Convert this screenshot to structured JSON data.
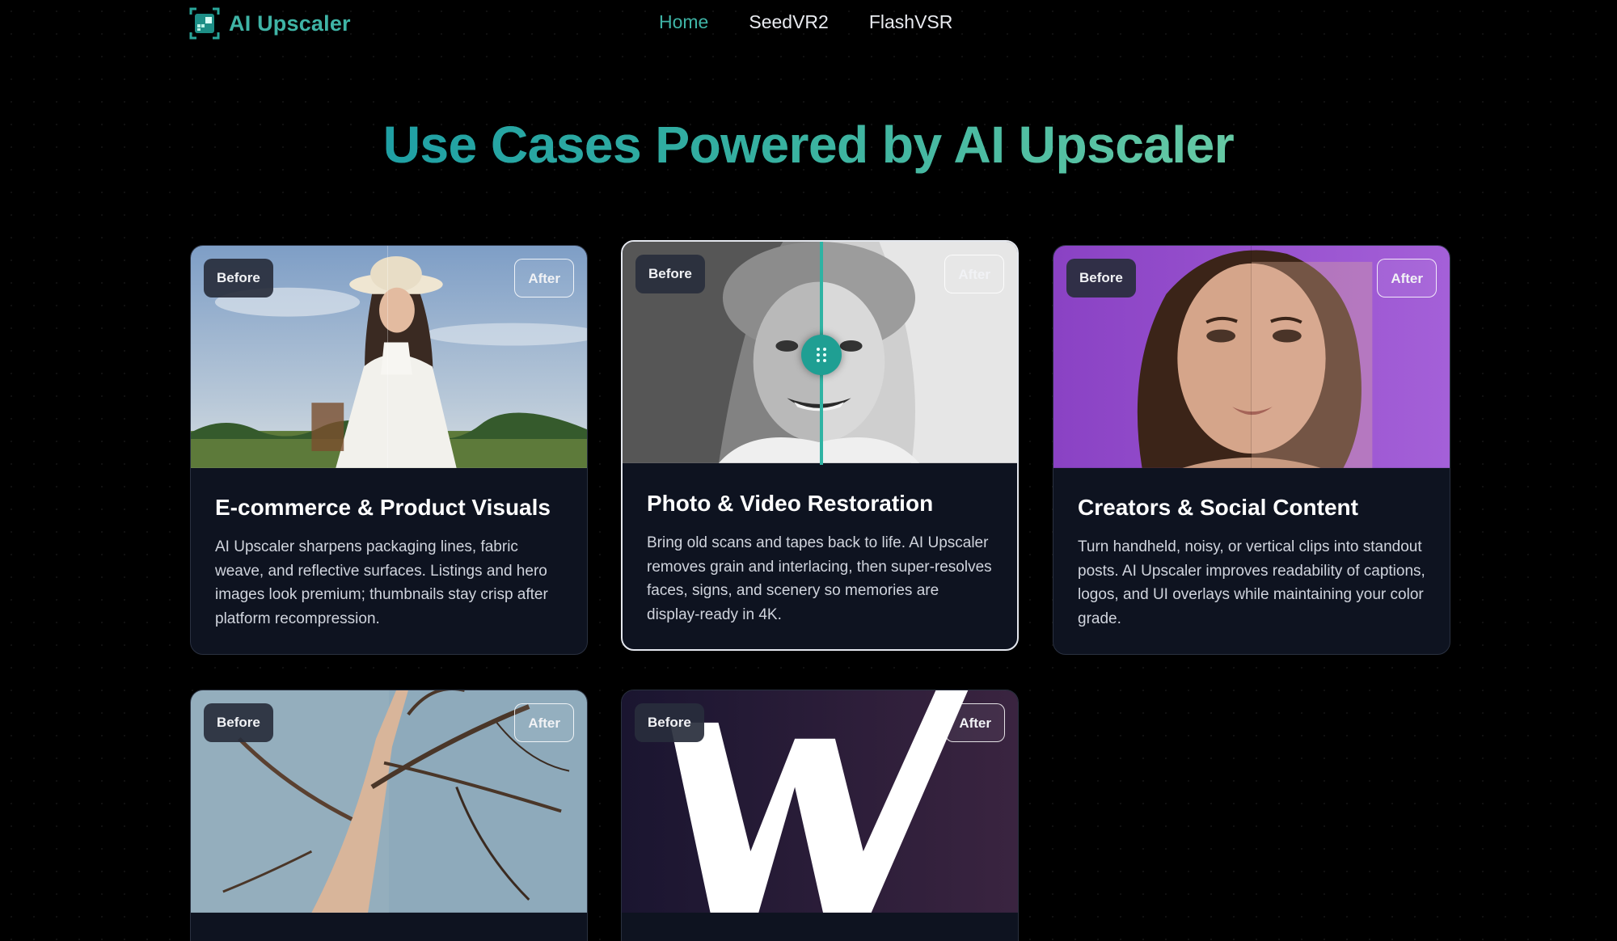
{
  "brand": {
    "name": "AI Upscaler",
    "accent": "#3fb4a6"
  },
  "nav": {
    "items": [
      {
        "label": "Home",
        "active": true
      },
      {
        "label": "SeedVR2",
        "active": false
      },
      {
        "label": "FlashVSR",
        "active": false
      }
    ]
  },
  "hero": {
    "title": "Use Cases Powered by AI Upscaler"
  },
  "labels": {
    "before": "Before",
    "after": "After"
  },
  "cards": [
    {
      "title": "E-commerce & Product Visuals",
      "description": "AI Upscaler sharpens packaging lines, fabric weave, and reflective surfaces. Listings and hero images look premium; thumbnails stay crisp after platform recompression."
    },
    {
      "title": "Photo & Video Restoration",
      "description": "Bring old scans and tapes back to life. AI Upscaler removes grain and interlacing, then super-resolves faces, signs, and scenery so memories are display-ready in 4K."
    },
    {
      "title": "Creators & Social Content",
      "description": "Turn handheld, noisy, or vertical clips into standout posts. AI Upscaler improves readability of captions, logos, and UI overlays while maintaining your color grade."
    },
    {
      "title": "",
      "description": ""
    },
    {
      "title": "",
      "description": ""
    }
  ]
}
